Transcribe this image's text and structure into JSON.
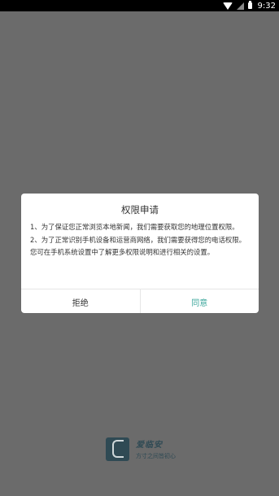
{
  "status_bar": {
    "time": "9:32",
    "icons": [
      "wifi-icon",
      "signal-icon",
      "battery-icon"
    ]
  },
  "dialog": {
    "title": "权限申请",
    "paragraphs": [
      "1、为了保证您正常浏览本地新闻，我们需要获取您的地理位置权限。",
      "2、为了正常识别手机设备和运营商网络，我们需要获得您的电话权限。",
      "您可在手机系统设置中了解更多权限说明和进行相关的设置。"
    ],
    "reject_label": "拒绝",
    "agree_label": "同意"
  },
  "brand": {
    "name": "爱临安",
    "slogan": "方寸之间皆初心"
  },
  "colors": {
    "overlay": "#6b6b6b",
    "accent": "#3da79c",
    "brand": "#2f4a54"
  }
}
